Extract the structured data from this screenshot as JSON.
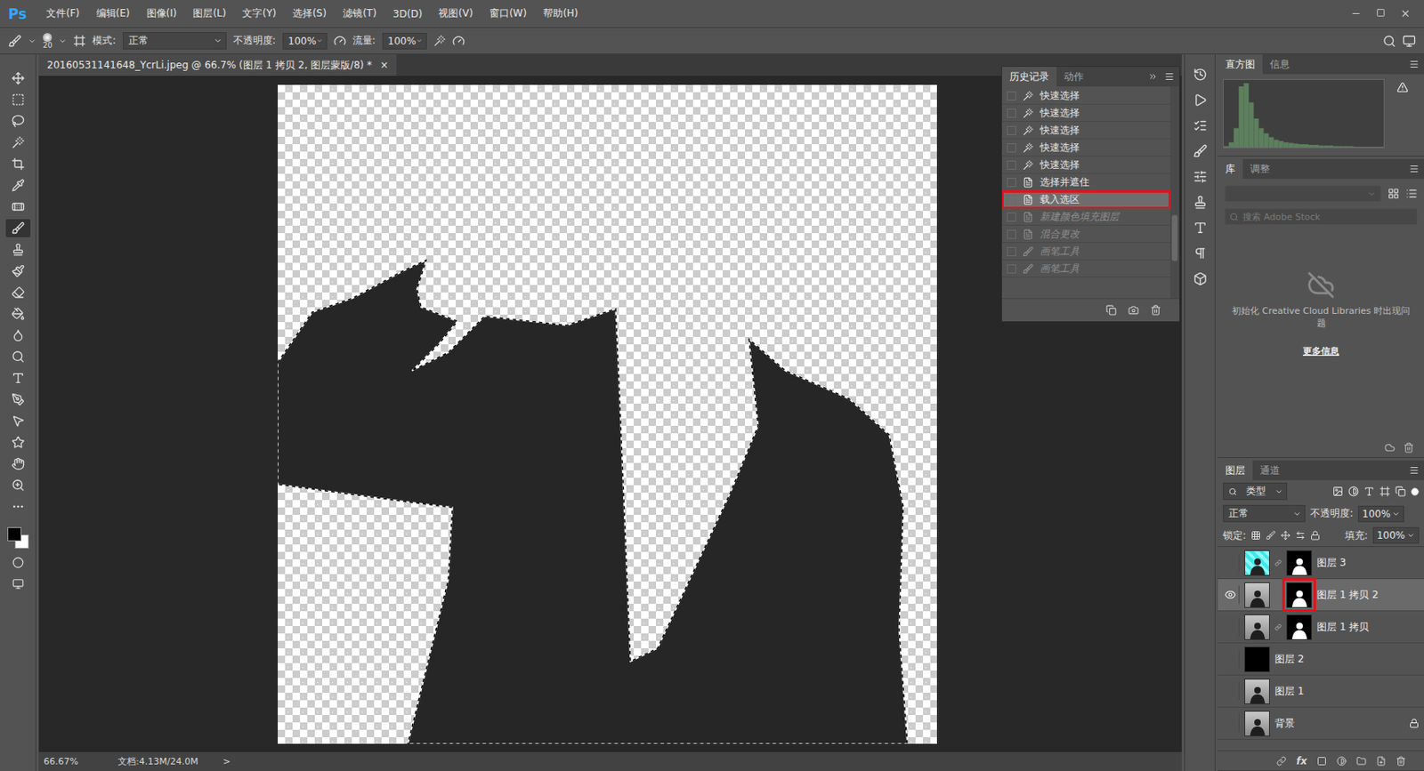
{
  "app": {
    "logo": "Ps",
    "menus": [
      "文件(F)",
      "编辑(E)",
      "图像(I)",
      "图层(L)",
      "文字(Y)",
      "选择(S)",
      "滤镜(T)",
      "3D(D)",
      "视图(V)",
      "窗口(W)",
      "帮助(H)"
    ]
  },
  "options_bar": {
    "brush_size": "20",
    "mode_label": "模式:",
    "mode": "正常",
    "opacity_label": "不透明度:",
    "opacity": "100%",
    "flow_label": "流量:",
    "flow": "100%"
  },
  "tools": [
    {
      "selected": false
    },
    {
      "selected": false
    },
    {
      "selected": false
    },
    {
      "selected": false
    },
    {
      "selected": false
    },
    {
      "selected": false
    },
    {
      "selected": false
    },
    {
      "selected": true
    },
    {
      "selected": false
    },
    {
      "selected": false
    },
    {
      "selected": false
    },
    {
      "selected": false
    },
    {
      "selected": false
    },
    {
      "selected": false
    },
    {
      "selected": false
    },
    {
      "selected": false
    },
    {
      "selected": false
    },
    {
      "selected": false
    },
    {
      "selected": false
    },
    {
      "selected": false
    },
    {
      "selected": false
    }
  ],
  "colors": {
    "foreground": "#000000",
    "background": "#ffffff"
  },
  "document": {
    "tab": "20160531141648_YcrLi.jpeg @ 66.7% (图层 1 拷贝 2, 图层蒙版/8) *",
    "close": "×"
  },
  "history_panel": {
    "tabs": [
      {
        "label": "历史记录",
        "selected": true
      },
      {
        "label": "动作",
        "selected": false
      }
    ],
    "items": [
      {
        "label": "快速选择",
        "kind": "quick-select",
        "selected": false,
        "disabled": false,
        "highlighted": false
      },
      {
        "label": "快速选择",
        "kind": "quick-select",
        "selected": false,
        "disabled": false,
        "highlighted": false
      },
      {
        "label": "快速选择",
        "kind": "quick-select",
        "selected": false,
        "disabled": false,
        "highlighted": false
      },
      {
        "label": "快速选择",
        "kind": "quick-select",
        "selected": false,
        "disabled": false,
        "highlighted": false
      },
      {
        "label": "快速选择",
        "kind": "quick-select",
        "selected": false,
        "disabled": false,
        "highlighted": false
      },
      {
        "label": "选择并遮住",
        "kind": "document",
        "selected": false,
        "disabled": false,
        "highlighted": false
      },
      {
        "label": "载入选区",
        "kind": "document",
        "selected": true,
        "disabled": false,
        "highlighted": true
      },
      {
        "label": "新建颜色填充图层",
        "kind": "document",
        "selected": false,
        "disabled": true,
        "highlighted": false
      },
      {
        "label": "混合更改",
        "kind": "document",
        "selected": false,
        "disabled": true,
        "highlighted": false
      },
      {
        "label": "画笔工具",
        "kind": "brush",
        "selected": false,
        "disabled": true,
        "highlighted": false
      },
      {
        "label": "画笔工具",
        "kind": "brush",
        "selected": false,
        "disabled": true,
        "highlighted": false
      }
    ]
  },
  "histogram_panel": {
    "tabs": [
      {
        "label": "直方图",
        "selected": true
      },
      {
        "label": "信息",
        "selected": false
      }
    ],
    "warning": true,
    "values": [
      2,
      8,
      30,
      95,
      100,
      70,
      45,
      30,
      22,
      16,
      12,
      10,
      8,
      7,
      6,
      5,
      5,
      4,
      4,
      3,
      3,
      3,
      2,
      2,
      2,
      2,
      1,
      1,
      1,
      1,
      1,
      1
    ]
  },
  "library_panel": {
    "tabs": [
      {
        "label": "库",
        "selected": true
      },
      {
        "label": "调整",
        "selected": false
      }
    ],
    "search_placeholder": "搜索 Adobe Stock",
    "message": "初始化 Creative Cloud Libraries 时出现问题",
    "link": "更多信息"
  },
  "layers_panel": {
    "tabs": [
      {
        "label": "图层",
        "selected": true
      },
      {
        "label": "通道",
        "selected": false
      }
    ],
    "filter_label": "类型",
    "blend_mode": "正常",
    "opacity_label": "不透明度:",
    "opacity": "100%",
    "lock_label": "锁定:",
    "fill_label": "填充:",
    "fill": "100%",
    "layers": [
      {
        "name": "图层 3",
        "visible": false,
        "selected": false,
        "thumb": "cyan",
        "has_mask": true,
        "linked": true,
        "mask_highlighted": false,
        "locked": false
      },
      {
        "name": "图层 1 拷贝 2",
        "visible": true,
        "selected": true,
        "thumb": "photo",
        "has_mask": true,
        "linked": false,
        "mask_highlighted": true,
        "locked": false
      },
      {
        "name": "图层 1 拷贝",
        "visible": false,
        "selected": false,
        "thumb": "photo",
        "has_mask": true,
        "linked": true,
        "mask_highlighted": false,
        "locked": false
      },
      {
        "name": "图层 2",
        "visible": false,
        "selected": false,
        "thumb": "black",
        "has_mask": false,
        "linked": false,
        "mask_highlighted": false,
        "locked": false
      },
      {
        "name": "图层 1",
        "visible": false,
        "selected": false,
        "thumb": "photo",
        "has_mask": false,
        "linked": false,
        "mask_highlighted": false,
        "locked": false
      },
      {
        "name": "背景",
        "visible": false,
        "selected": false,
        "thumb": "photo",
        "has_mask": false,
        "linked": false,
        "mask_highlighted": false,
        "locked": true
      }
    ],
    "actions": [
      "fx"
    ]
  },
  "status_bar": {
    "zoom": "66.67%",
    "doc_info": "文档:4.13M/24.0M",
    "arrow": ">"
  }
}
